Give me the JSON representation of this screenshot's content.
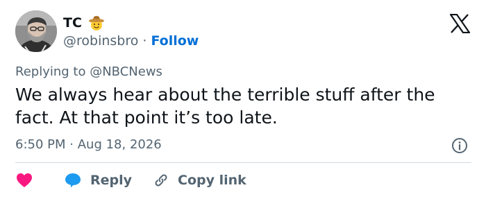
{
  "author": {
    "display_name": "TC",
    "emoji": "cowboy-face",
    "handle": "@robinsbro",
    "separator": "·",
    "follow_label": "Follow"
  },
  "platform_icon": "x-logo-icon",
  "reply_context": {
    "prefix": "Replying to",
    "mention": "@NBCNews"
  },
  "tweet": {
    "text": "We always hear about the terrible stuff after the fact. At that point it’s too late.",
    "time": "6:50 PM",
    "separator": "·",
    "date": "Aug 18, 2026"
  },
  "actions": {
    "like_icon": "heart-icon",
    "reply_label": "Reply",
    "copy_label": "Copy link"
  },
  "colors": {
    "accent": "#006fd6",
    "like": "#f91880",
    "reply": "#1d9bf0",
    "muted": "#536471",
    "divider": "#cfd9de"
  }
}
